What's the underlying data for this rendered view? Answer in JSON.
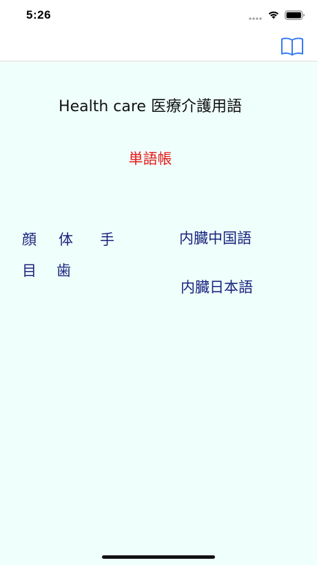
{
  "status_bar": {
    "time": "5:26"
  },
  "nav_bar": {
    "right_icon": "book-icon",
    "accent_color": "#3478f6"
  },
  "main": {
    "title": "Health care 医療介護用語",
    "wordbook_link": "単語帳",
    "categories": {
      "face": "顔",
      "body": "体",
      "hand": "手",
      "eye": "目",
      "tooth": "歯",
      "organs_chinese": "内臓中国語",
      "organs_japanese": "内臓日本語"
    }
  },
  "colors": {
    "background": "#effffb",
    "title": "#111111",
    "wordbook": "#e61919",
    "category": "#1a237e"
  }
}
